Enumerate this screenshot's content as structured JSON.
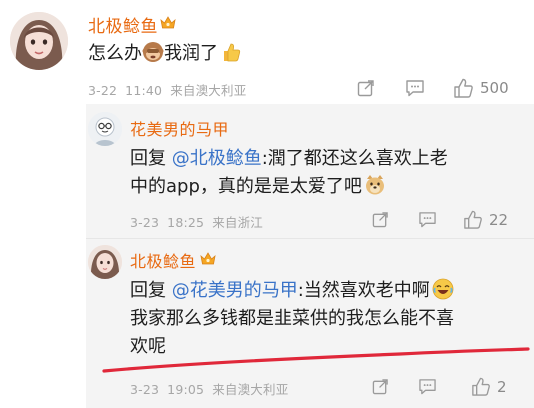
{
  "comment": {
    "username": "北极鲶鱼",
    "text_prefix": "怎么办",
    "text_suffix": "我润了",
    "date": "3-22",
    "time": "11:40",
    "location": "来自澳大利亚",
    "like_count": "500"
  },
  "reply1": {
    "username": "花美男的马甲",
    "reply_word": "回复",
    "mention": "@北极鲶鱼",
    "line1_rest": ":潤了都还这么喜欢上老",
    "line2": "中的app，真的是是太爱了吧",
    "date": "3-23",
    "time": "18:25",
    "location": "来自浙江",
    "like_count": "22"
  },
  "reply2": {
    "username": "北极鲶鱼",
    "reply_word": "回复",
    "mention": "@花美男的马甲",
    "line1_rest": ":当然喜欢老中啊",
    "line2": "我家那么多钱都是韭菜供的我怎么能不喜",
    "line3": "欢呢",
    "date": "3-23",
    "time": "19:05",
    "location": "来自澳大利亚",
    "like_count": "2"
  },
  "colors": {
    "username": "#e86a12",
    "mention": "#3a73c8",
    "meta": "#a6a6a6",
    "reply_bg": "#f4f4f4",
    "red_mark": "#e0283a"
  },
  "icons": [
    "vip-crown-icon",
    "monkey-emoji-icon",
    "thumbs-up-emoji-icon",
    "doge-emoji-icon",
    "laughing-emoji-icon",
    "share-icon",
    "comment-icon",
    "like-icon"
  ]
}
